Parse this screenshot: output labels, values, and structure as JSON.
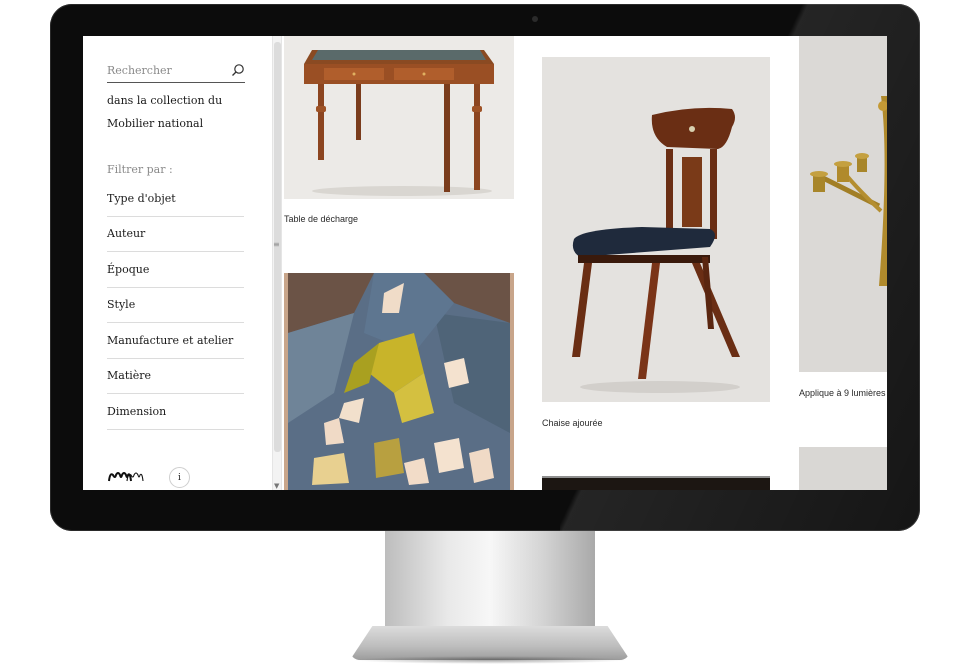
{
  "sidebar": {
    "search_placeholder": "Rechercher",
    "collection_line1": "dans la collection du",
    "collection_line2": "Mobilier national",
    "filter_title": "Filtrer par :",
    "filters": [
      {
        "label": "Type d'objet"
      },
      {
        "label": "Auteur"
      },
      {
        "label": "Époque"
      },
      {
        "label": "Style"
      },
      {
        "label": "Manufacture et atelier"
      },
      {
        "label": "Matière"
      },
      {
        "label": "Dimension"
      }
    ],
    "info_label": "i"
  },
  "gallery": {
    "items": [
      {
        "caption": "Table de décharge"
      },
      {
        "caption": "Chaise ajourée"
      },
      {
        "caption": "Applique à 9 lumières"
      }
    ]
  },
  "colors": {
    "bezel": "#0c0c0c",
    "screen_bg": "#ffffff",
    "text": "#1a1a1a",
    "muted": "#8a8a8a",
    "divider": "#dcdcdc"
  }
}
